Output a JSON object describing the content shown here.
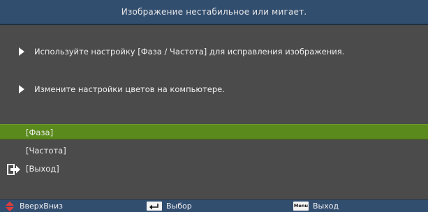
{
  "title": "Изображение нестабильное или мигает.",
  "tips": [
    {
      "text": "Используйте настройку [Фаза / Частота] для исправления изображения."
    },
    {
      "text": "Измените настройки цветов на компьютере."
    }
  ],
  "options": [
    {
      "label": "[Фаза]",
      "selected": true
    },
    {
      "label": "[Частота]",
      "selected": false
    },
    {
      "label": "[Выход]",
      "selected": false,
      "icon": "exit-icon"
    }
  ],
  "footer": {
    "updown_label": "ВверхВниз",
    "select_label": "Выбор",
    "menu_key_text": "Menu",
    "exit_label": "Выход"
  },
  "colors": {
    "title_bar": "#324e6f",
    "background": "#4b4b4b",
    "selected_row": "#5a8a1c",
    "updown_icon": "#e23b3b"
  },
  "icons": [
    "play-arrow-icon",
    "exit-icon",
    "updown-arrows-icon",
    "enter-key-icon",
    "menu-key-icon"
  ]
}
